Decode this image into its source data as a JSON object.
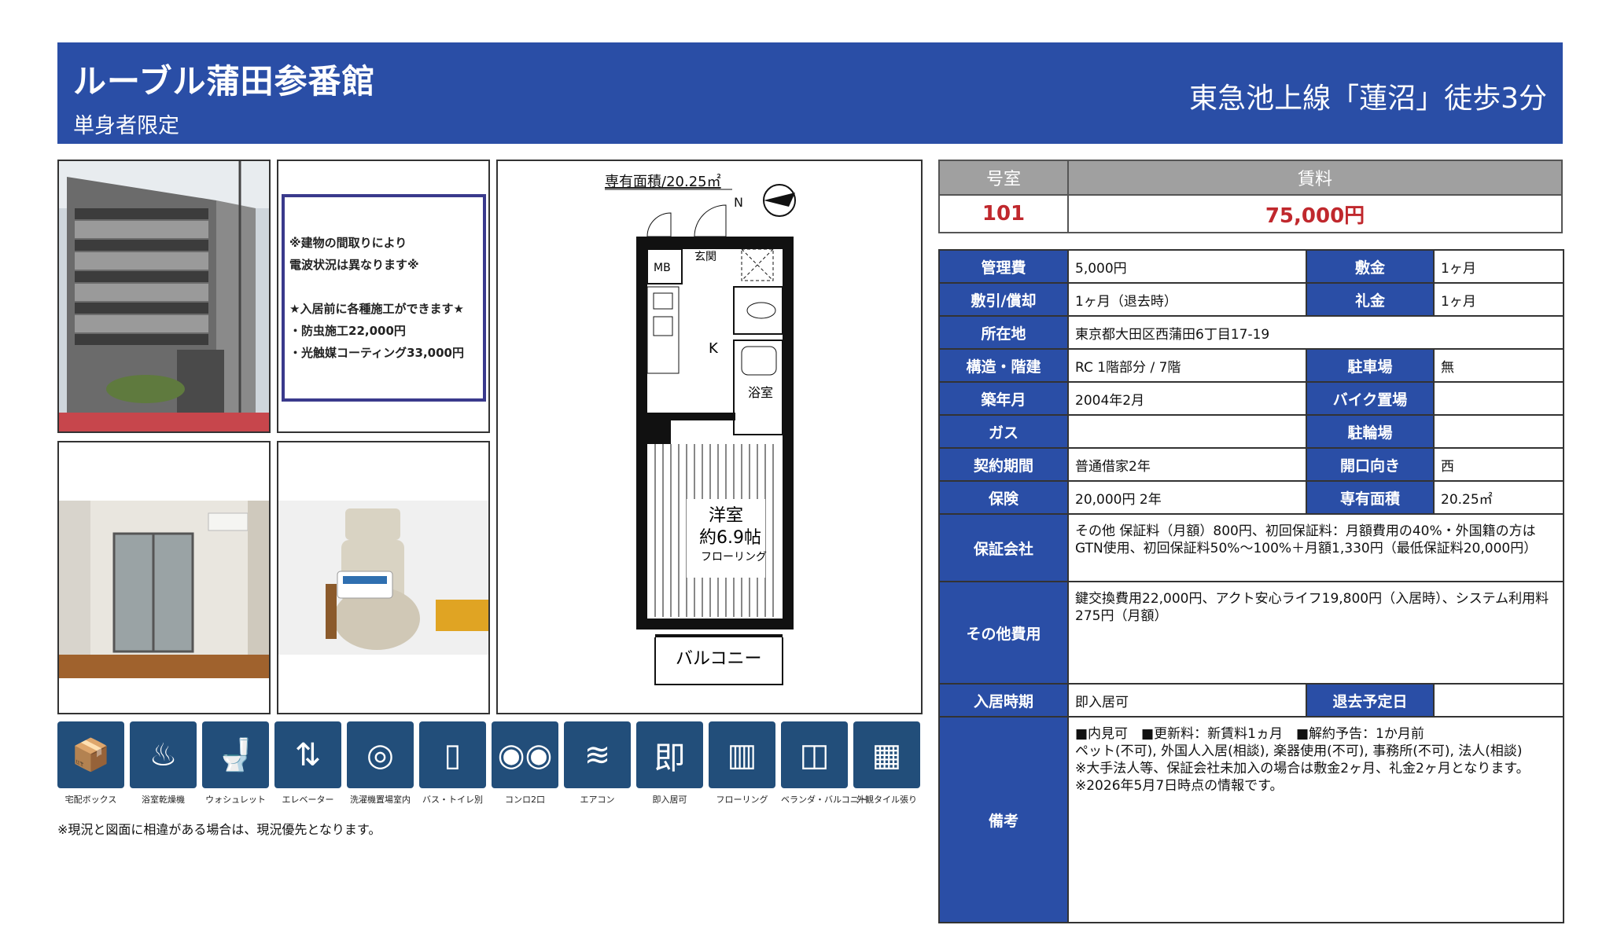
{
  "header": {
    "title": "ルーブル蒲田参番館",
    "subtitle": "単身者限定",
    "station": "東急池上線「蓮沼」徒歩3分"
  },
  "notice": {
    "line1": "※建物の間取りにより",
    "line2": "電波状況は異なります※",
    "line3": "★入居前に各種施工ができます★",
    "line4": "・防虫施工22,000円",
    "line5": "・光触媒コーティング33,000円"
  },
  "floorplan": {
    "area_label": "専有面積/20.25㎡",
    "mb": "MB",
    "entrance": "玄関",
    "kitchen": "K",
    "bath": "浴室",
    "room1": "洋室",
    "room2": "約6.9帖",
    "room3": "フローリング",
    "balcony": "バルコニー",
    "north": "N"
  },
  "icons": [
    {
      "icon": "package-box-icon",
      "label": "宅配ボックス"
    },
    {
      "icon": "bathroom-dryer-icon",
      "label": "浴室乾燥機"
    },
    {
      "icon": "washlet-icon",
      "label": "ウォシュレット"
    },
    {
      "icon": "elevator-icon",
      "label": "エレベーター"
    },
    {
      "icon": "washing-machine-icon",
      "label": "洗濯機置場室内"
    },
    {
      "icon": "bath-toilet-separate-icon",
      "label": "バス・トイレ別"
    },
    {
      "icon": "stove-2-burner-icon",
      "label": "コンロ2口"
    },
    {
      "icon": "air-conditioner-icon",
      "label": "エアコン"
    },
    {
      "icon": "immediate-move-in-icon",
      "label": "即入居可"
    },
    {
      "icon": "flooring-icon",
      "label": "フローリング"
    },
    {
      "icon": "veranda-icon",
      "label": "ベランダ・バルコニー"
    },
    {
      "icon": "tile-exterior-icon",
      "label": "外観タイル張り"
    }
  ],
  "icon_glyphs": [
    "📦",
    "♨",
    "🚽",
    "⇅",
    "◎",
    "▯",
    "◉◉",
    "≋",
    "即",
    "▥",
    "◫",
    "▦"
  ],
  "note": "※現況と図面に相違がある場合は、現況優先となります。",
  "room": {
    "room_header": "号室",
    "rent_header": "賃料",
    "room_no": "101",
    "rent": "75,000円"
  },
  "info": {
    "kanrihi_label": "管理費",
    "kanrihi": "5,000円",
    "shikikin_label": "敷金",
    "shikikin": "1ヶ月",
    "shikibiki_label": "敷引/償却",
    "shikibiki": "1ヶ月（退去時）",
    "reikin_label": "礼金",
    "reikin": "1ヶ月",
    "address_label": "所在地",
    "address": "東京都大田区西蒲田6丁目17-19",
    "structure_label": "構造・階建",
    "structure": "RC 1階部分 / 7階",
    "parking_label": "駐車場",
    "parking": "無",
    "built_label": "築年月",
    "built": "2004年2月",
    "bike_label": "バイク置場",
    "bike": "",
    "gas_label": "ガス",
    "gas": "",
    "bicycle_label": "駐輪場",
    "bicycle": "",
    "contract_label": "契約期間",
    "contract": "普通借家2年",
    "direction_label": "開口向き",
    "direction": "西",
    "insurance_label": "保険",
    "insurance": "20,000円 2年",
    "area_label": "専有面積",
    "area": "20.25㎡",
    "guarantor_label": "保証会社",
    "guarantor_line1": "その他 保証料（月額）800円、初回保証料：月額費用の40%・外国籍の方は",
    "guarantor_line2": "GTN使用、初回保証料50%～100%＋月額1,330円（最低保証料20,000円）",
    "other_label": "その他費用",
    "other_line1": "鍵交換費用22,000円、アクト安心ライフ19,800円（入居時）、システム利用料",
    "other_line2": "275円（月額）",
    "movein_label": "入居時期",
    "movein": "即入居可",
    "leave_label": "退去予定日",
    "leave": "",
    "remarks_label": "備考",
    "remarks_line1": "■内見可　■更新料：新賃料1ヵ月　■解約予告：1か月前",
    "remarks_line2": "ペット(不可), 外国人入居(相談), 楽器使用(不可), 事務所(不可), 法人(相談)",
    "remarks_line3": "※大手法人等、保証会社未加入の場合は敷金2ヶ月、礼金2ヶ月となります。",
    "remarks_line4": "※2026年5月7日時点の情報です。"
  }
}
